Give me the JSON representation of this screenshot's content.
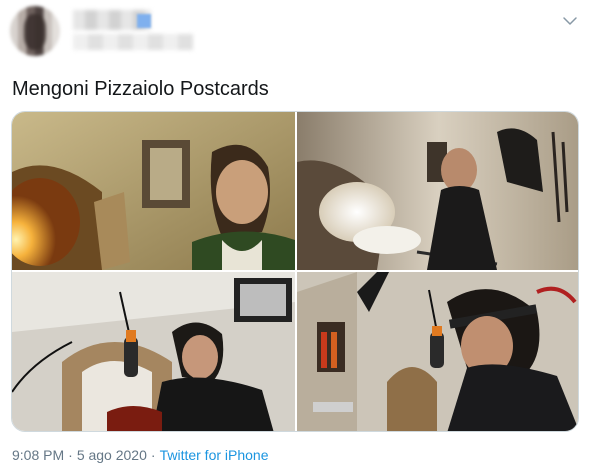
{
  "tweet": {
    "text": "Mengoni Pizzaiolo Postcards",
    "time": "9:08 PM",
    "separator": "·",
    "date": "5 ago 2020",
    "source": "Twitter for iPhone"
  },
  "icons": {
    "menu": "chevron-down-icon"
  },
  "colors": {
    "text": "#14171a",
    "meta": "#657786",
    "link": "#1b95e0"
  }
}
